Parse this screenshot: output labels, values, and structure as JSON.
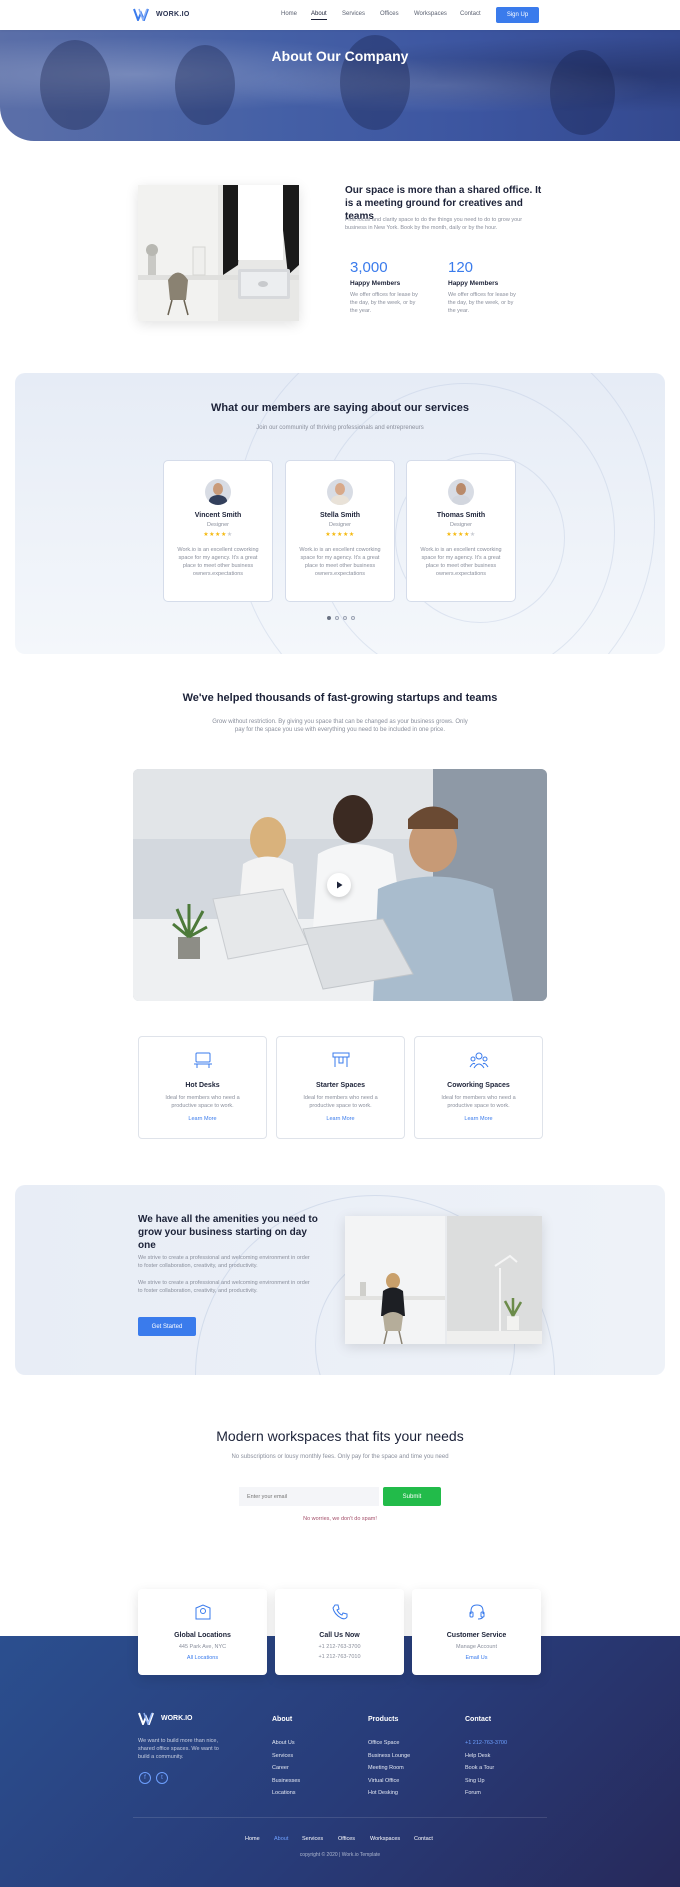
{
  "nav": {
    "logo_text": "WORK.IO",
    "links": [
      "Home",
      "About",
      "Services",
      "Offices",
      "Workspaces",
      "Contact"
    ],
    "active": "About",
    "signup_label": "Sign Up"
  },
  "hero": {
    "title": "About Our Company"
  },
  "intro": {
    "title": "Our space is more than a shared office. It is a meeting ground for creatives and teams",
    "desc": "Find focus and clarity space to do the things you need to do to grow your business in New York. Book by the month, daily or by the hour.",
    "stats": [
      {
        "num": "3,000",
        "label": "Happy Members",
        "text": "We offer offices for lease by the day, by the week, or by the year."
      },
      {
        "num": "120",
        "label": "Happy Members",
        "text": "We offer offices for lease by the day, by the week, or by the year."
      }
    ]
  },
  "testimonials": {
    "title": "What our members are saying about our services",
    "subtitle": "Join our community of thriving professionals and entrepreneurs",
    "items": [
      {
        "name": "Vincent Smith",
        "role": "Designer",
        "rating": 4,
        "quote": "Work.io is an excellent coworking space for my agency. It's a great place to meet other business owners.expectations"
      },
      {
        "name": "Stella Smith",
        "role": "Designer",
        "rating": 5,
        "quote": "Work.io is an excellent coworking space for my agency. It's a great place to meet other business owners.expectations"
      },
      {
        "name": "Thomas Smith",
        "role": "Designer",
        "rating": 4,
        "quote": "Work.io is an excellent coworking space for my agency. It's a great place to meet other business owners.expectations"
      }
    ],
    "star_on": "★",
    "star_off": "★"
  },
  "startups": {
    "title": "We've helped thousands of fast-growing startups and teams",
    "desc": "Grow without restriction. By giving you space that can be changed as your business grows. Only pay for the space you use with everything you need to be included in one price."
  },
  "spaces": [
    {
      "title": "Hot Desks",
      "desc": "Ideal for members who need a productive space to work.",
      "link": "Learn More",
      "icon": "desk-icon"
    },
    {
      "title": "Starter Spaces",
      "desc": "Ideal for members who need a productive space to work.",
      "link": "Learn More",
      "icon": "table-icon"
    },
    {
      "title": "Coworking Spaces",
      "desc": "Ideal for members who need a productive space to work.",
      "link": "Learn More",
      "icon": "people-icon"
    }
  ],
  "amenities": {
    "title": "We have all the amenities you need to grow your business starting on day one",
    "p1": "We strive to create a professional and welcoming environment in order to foster collaboration, creativity, and productivity.",
    "p2": "We strive to create a professional and welcoming environment in order to foster collaboration, creativity, and productivity.",
    "button": "Get Started"
  },
  "subscribe": {
    "title": "Modern workspaces that fits your needs",
    "subtitle": "No subscriptions or lousy monthly fees. Only pay for the space and time you need",
    "placeholder": "Enter your email",
    "button": "Submit",
    "note": "No worries, we don't do spam!"
  },
  "contact_cards": [
    {
      "title": "Global Locations",
      "line1": "445 Park Ave, NYC",
      "line2": "",
      "link": "All Locations",
      "icon": "map-pin-icon"
    },
    {
      "title": "Call Us Now",
      "line1": "+1 212-763-3700",
      "line2": "+1 212-763-7010",
      "link": "",
      "icon": "phone-icon"
    },
    {
      "title": "Customer Service",
      "line1": "Manage Account",
      "line2": "",
      "link": "Email Us",
      "icon": "headset-icon"
    }
  ],
  "footer": {
    "logo_text": "WORK.IO",
    "desc": "We want to build more than nice, shared office spaces. We want to build a community.",
    "columns": [
      {
        "heading": "About",
        "links": [
          "About Us",
          "Services",
          "Career",
          "Businesses",
          "Locations"
        ]
      },
      {
        "heading": "Products",
        "links": [
          "Office Space",
          "Business Lounge",
          "Meeting Room",
          "Virtual Office",
          "Hot Desking"
        ]
      },
      {
        "heading": "Contact",
        "links": [
          "+1 212-763-3700",
          "Help Desk",
          "Book a Tour",
          "Sing Up",
          "Forum"
        ]
      }
    ],
    "bottom_nav": [
      "Home",
      "About",
      "Services",
      "Offices",
      "Workspaces",
      "Contact"
    ],
    "bottom_active": "About",
    "copyright": "copyright © 2020  |  Work.io Template",
    "social": [
      "f",
      "t"
    ]
  },
  "colors": {
    "accent": "#3a7bec",
    "submit": "#22bb4a",
    "footer": "#283b78"
  }
}
